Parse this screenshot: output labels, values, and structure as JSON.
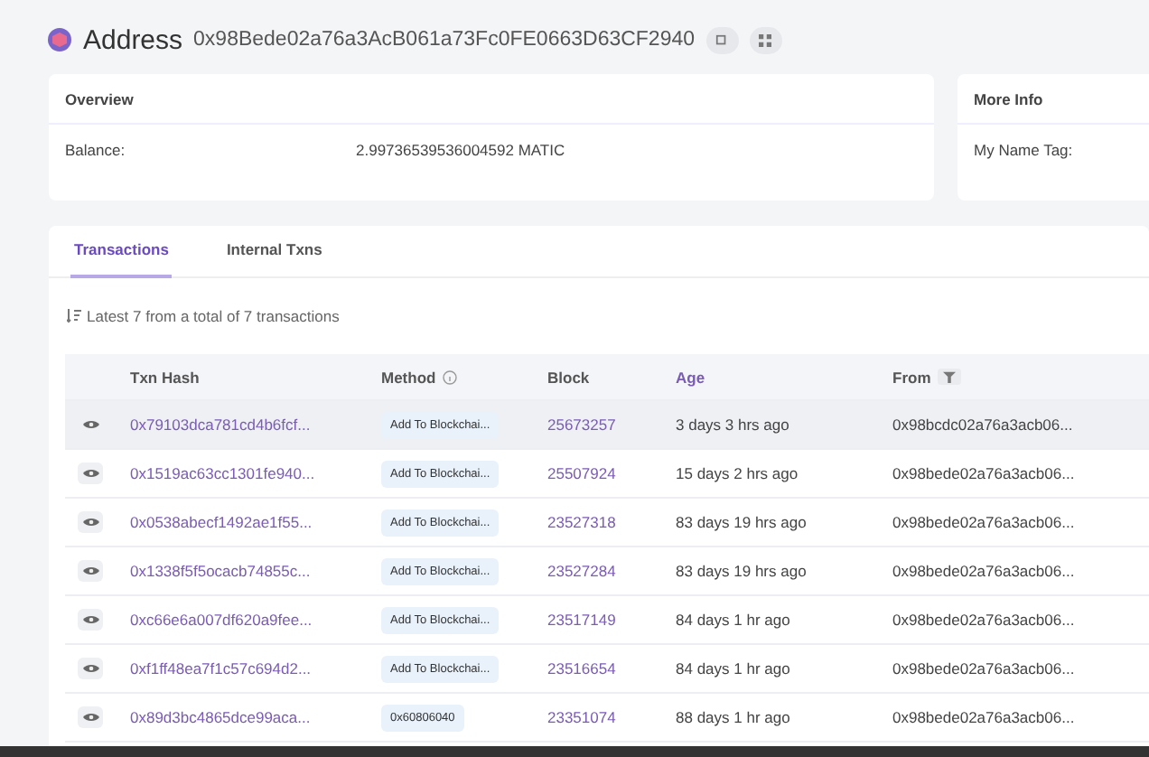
{
  "header": {
    "title": "Address",
    "address": "0x98Bede02a76a3AcB061a73Fc0FE0663D63CF2940"
  },
  "overview": {
    "title": "Overview",
    "label": "Balance:",
    "value": "2.99736539536004592 MATIC"
  },
  "more_info": {
    "title": "More Info",
    "label": "My Name Tag:"
  },
  "tabs": [
    {
      "label": "Transactions",
      "selected": true
    },
    {
      "label": "Internal Txns",
      "selected": false
    }
  ],
  "summary": "Latest 7 from a total of 7 transactions",
  "table": {
    "columns": [
      {
        "label": "Txn Hash",
        "kind": "plain"
      },
      {
        "label": "Method",
        "kind": "info"
      },
      {
        "label": "Block",
        "kind": "plain"
      },
      {
        "label": "Age",
        "kind": "link"
      },
      {
        "label": "From",
        "kind": "filter"
      }
    ],
    "rows": [
      {
        "hash": "0x79103dca781cd4b6fcf...",
        "method": "Add To Blockchai...",
        "block": "25673257",
        "age": "3 days 3 hrs ago",
        "from": "0x98bcdc02a76a3acb06...",
        "selected": true
      },
      {
        "hash": "0x1519ac63cc1301fe940...",
        "method": "Add To Blockchai...",
        "block": "25507924",
        "age": "15 days 2 hrs ago",
        "from": "0x98bede02a76a3acb06...",
        "selected": false
      },
      {
        "hash": "0x0538abecf1492ae1f55...",
        "method": "Add To Blockchai...",
        "block": "23527318",
        "age": "83 days 19 hrs ago",
        "from": "0x98bede02a76a3acb06...",
        "selected": false
      },
      {
        "hash": "0x1338f5f5ocacb74855c...",
        "method": "Add To Blockchai...",
        "block": "23527284",
        "age": "83 days 19 hrs ago",
        "from": "0x98bede02a76a3acb06...",
        "selected": false
      },
      {
        "hash": "0xc66e6a007df620a9fee...",
        "method": "Add To Blockchai...",
        "block": "23517149",
        "age": "84 days 1 hr ago",
        "from": "0x98bede02a76a3acb06...",
        "selected": false
      },
      {
        "hash": "0xf1ff48ea7f1c57c694d2...",
        "method": "Add To Blockchai...",
        "block": "23516654",
        "age": "84 days 1 hr ago",
        "from": "0x98bede02a76a3acb06...",
        "selected": false
      },
      {
        "hash": "0x89d3bc4865dce99aca...",
        "method": "0x60806040",
        "block": "23351074",
        "age": "88 days 1 hr ago",
        "from": "0x98bede02a76a3acb06...",
        "selected": false
      }
    ]
  }
}
